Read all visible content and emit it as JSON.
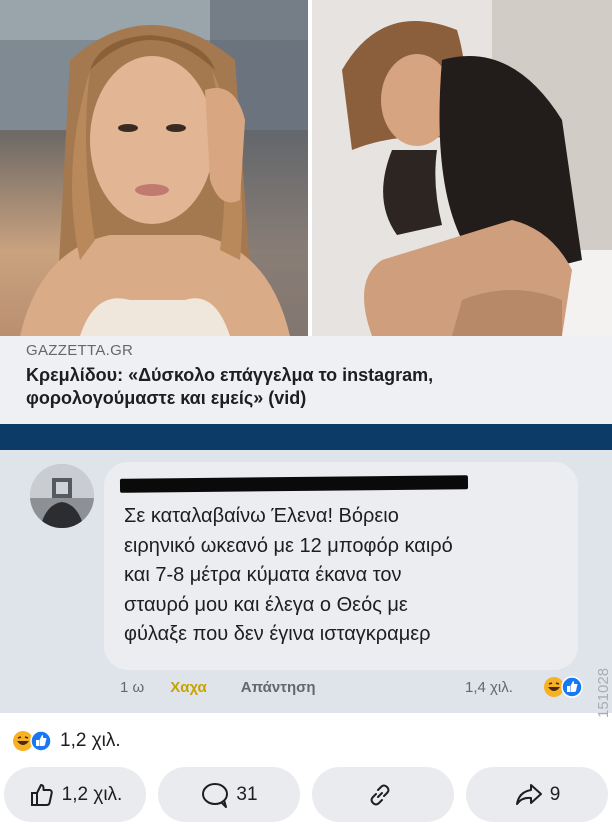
{
  "post": {
    "images": [
      {
        "description_icon": "portrait-photo-icon"
      },
      {
        "description_icon": "portrait-photo-icon"
      }
    ],
    "link_source": "GAZZETTA.GR",
    "link_headline": "Κρεμλίδου: «Δύσκολο επάγγελμα το instagram, φορολογούμαστε και εμείς» (vid)",
    "accent_color": "#0c3b68"
  },
  "comment": {
    "text": "Σε καταλαβαίνω Έλενα! Βόρειο\nειρηνικό ωκεανό με 12 μποφόρ καιρό\nκαι 7-8 μέτρα κύματα έκανα τον\nσταυρό μου και έλεγα ο Θεός με\nφύλαξε που δεν έγινα ισταγκραμερ",
    "time": "1 ω",
    "haha_label": "Χαχα",
    "reply_label": "Απάντηση",
    "reaction_count": "1,4 χιλ.",
    "watermark": "151028"
  },
  "summary": {
    "reaction_count": "1,2 χιλ."
  },
  "action_bar": {
    "like_count": "1,2 χιλ.",
    "comment_count": "31",
    "share_count": "9"
  },
  "colors": {
    "like_blue": "#1877f2",
    "haha_yellow": "#f7b125"
  }
}
